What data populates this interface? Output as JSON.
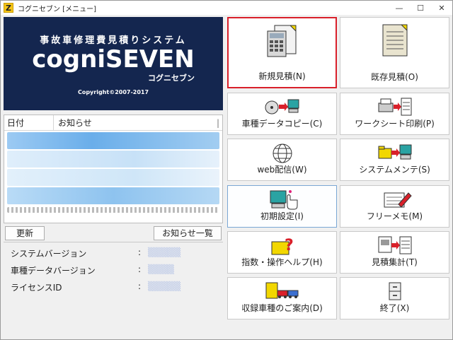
{
  "window": {
    "app_icon": "Z",
    "title": "コグニセブン [メニュー]",
    "controls": [
      "—",
      "☐",
      "✕"
    ]
  },
  "banner": {
    "tagline": "事故車修理費見積りシステム",
    "logo": "cogniSEVEN",
    "logo_kana": "コグニセブン",
    "copyright": "Copyright©2007-2017"
  },
  "news": {
    "columns": [
      "日付",
      "お知らせ",
      "|"
    ],
    "row_count": 4
  },
  "left_buttons": {
    "refresh": "更新",
    "news_list": "お知らせ一覧"
  },
  "info": {
    "system_version_label": "システムバージョン",
    "vehicle_data_version_label": "車種データバージョン",
    "license_id_label": "ライセンスID",
    "colon": ":"
  },
  "tiles": {
    "new_estimate": "新規見積(N)",
    "existing_estimate": "既存見積(O)",
    "vehicle_data_copy": "車種データコピー(C)",
    "worksheet_print": "ワークシート印刷(P)",
    "web_distribution": "web配信(W)",
    "system_maintenance": "システムメンテ(S)",
    "initial_settings": "初期設定(I)",
    "free_memo": "フリーメモ(M)",
    "index_help": "指数・操作ヘルプ(H)",
    "estimate_total": "見積集計(T)",
    "recorded_vehicles": "収録車種のご案内(D)",
    "exit": "終了(X)"
  },
  "colors": {
    "banner_bg": "#14264f",
    "active_border": "#d9202a",
    "selection_blue": "#6aaeea"
  }
}
